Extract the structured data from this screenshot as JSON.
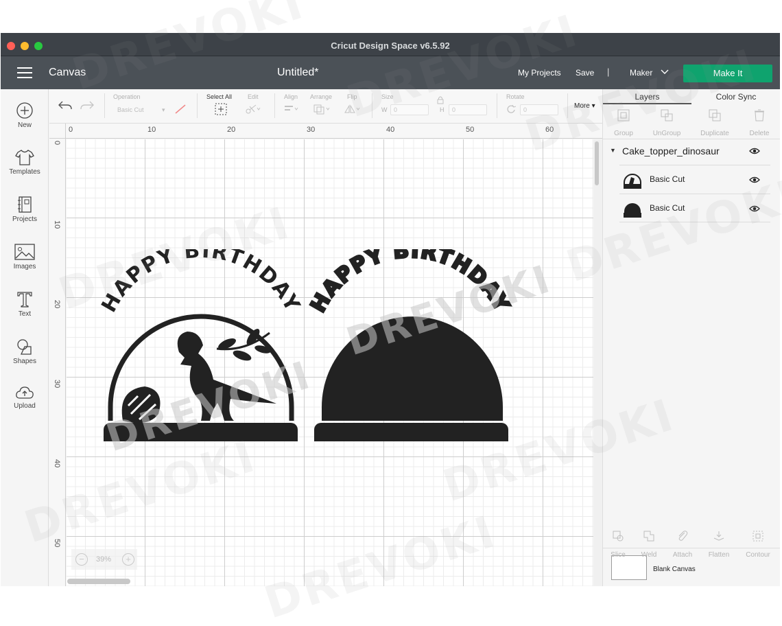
{
  "window": {
    "title": "Cricut Design Space  v6.5.92"
  },
  "header": {
    "section": "Canvas",
    "doc_title": "Untitled*",
    "my_projects": "My Projects",
    "save": "Save",
    "separator": "|",
    "machine": "Maker",
    "make_it": "Make It",
    "colors": {
      "make_it_bg": "#0fa36e",
      "header_bg": "#4b5157"
    }
  },
  "sidebar": {
    "items": [
      {
        "label": "New",
        "icon": "plus-circle-icon"
      },
      {
        "label": "Templates",
        "icon": "tshirt-icon"
      },
      {
        "label": "Projects",
        "icon": "notebook-icon"
      },
      {
        "label": "Images",
        "icon": "image-icon"
      },
      {
        "label": "Text",
        "icon": "text-t-icon"
      },
      {
        "label": "Shapes",
        "icon": "shapes-icon"
      },
      {
        "label": "Upload",
        "icon": "cloud-upload-icon"
      }
    ]
  },
  "toolbar": {
    "operation_label": "Operation",
    "operation_value": "Basic Cut",
    "select_all": "Select All",
    "edit": "Edit",
    "align": "Align",
    "arrange": "Arrange",
    "flip": "Flip",
    "size": "Size",
    "w_label": "W",
    "w_value": "0",
    "h_label": "H",
    "h_value": "0",
    "rotate": "Rotate",
    "rotate_value": "0",
    "more": "More"
  },
  "canvas": {
    "ruler_top": [
      "0",
      "10",
      "20",
      "30",
      "40",
      "50",
      "60"
    ],
    "ruler_left": [
      "0",
      "10",
      "20",
      "30",
      "40",
      "50"
    ],
    "zoom": "39%",
    "design_text_left": "HAPPY BIRTHDAY",
    "design_text_right": "HAPPY BIRTHDAY"
  },
  "panel": {
    "tabs": [
      "Layers",
      "Color Sync"
    ],
    "actions": [
      "Group",
      "UnGroup",
      "Duplicate",
      "Delete"
    ],
    "group_name": "Cake_topper_dinosaur",
    "layers": [
      {
        "label": "Basic Cut"
      },
      {
        "label": "Basic Cut"
      }
    ],
    "blank_canvas": "Blank Canvas",
    "bottom_actions": [
      "Slice",
      "Weld",
      "Attach",
      "Flatten",
      "Contour"
    ]
  },
  "watermark": "DREVOKI"
}
